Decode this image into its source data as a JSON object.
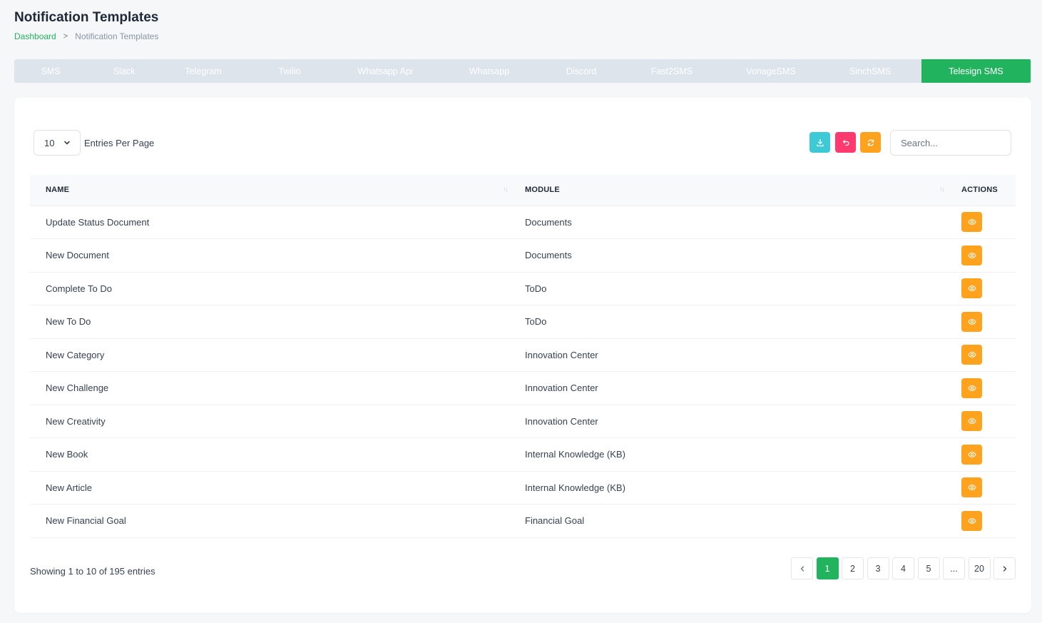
{
  "page": {
    "title": "Notification Templates"
  },
  "breadcrumb": {
    "home": "Dashboard",
    "separator": ">",
    "current": "Notification Templates"
  },
  "tabs": [
    {
      "label": "SMS",
      "active": false
    },
    {
      "label": "Slack",
      "active": false
    },
    {
      "label": "Telegram",
      "active": false
    },
    {
      "label": "Twilio",
      "active": false
    },
    {
      "label": "Whatsapp Api",
      "active": false
    },
    {
      "label": "Whatsapp",
      "active": false
    },
    {
      "label": "Discord",
      "active": false
    },
    {
      "label": "Fast2SMS",
      "active": false
    },
    {
      "label": "VonageSMS",
      "active": false
    },
    {
      "label": "SinchSMS",
      "active": false
    },
    {
      "label": "Telesign SMS",
      "active": true
    }
  ],
  "controls": {
    "entries_value": "10",
    "entries_label": "Entries Per Page",
    "search_placeholder": "Search...",
    "toolbar_icons": [
      "download-icon",
      "reset-icon",
      "refresh-icon"
    ]
  },
  "table": {
    "headers": {
      "name": "NAME",
      "module": "MODULE",
      "actions": "ACTIONS"
    },
    "sort_glyph": "↑↓",
    "rows": [
      {
        "name": "Update Status Document",
        "module": "Documents"
      },
      {
        "name": "New Document",
        "module": "Documents"
      },
      {
        "name": "Complete To Do",
        "module": "ToDo"
      },
      {
        "name": "New To Do",
        "module": "ToDo"
      },
      {
        "name": "New Category",
        "module": "Innovation Center"
      },
      {
        "name": "New Challenge",
        "module": "Innovation Center"
      },
      {
        "name": "New Creativity",
        "module": "Innovation Center"
      },
      {
        "name": "New Book",
        "module": "Internal Knowledge (KB)"
      },
      {
        "name": "New Article",
        "module": "Internal Knowledge (KB)"
      },
      {
        "name": "New Financial Goal",
        "module": "Financial Goal"
      }
    ]
  },
  "footer": {
    "info": "Showing 1 to 10 of 195 entries",
    "pages": [
      "1",
      "2",
      "3",
      "4",
      "5",
      "...",
      "20"
    ],
    "active_page": "1"
  },
  "colors": {
    "accent": "#22b35e",
    "tab_bar": "#dde4ec",
    "download": "#3ec9d6",
    "reset": "#ff3a6e",
    "warning": "#ffa21d"
  }
}
